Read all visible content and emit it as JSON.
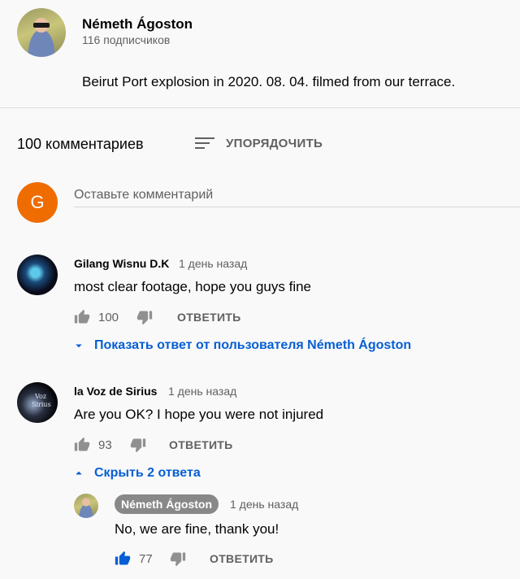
{
  "channel": {
    "name": "Németh Ágoston",
    "subscribers": "116 подписчиков",
    "description": "Beirut Port explosion in 2020. 08. 04. filmed from our terrace."
  },
  "comments_header": {
    "count": "100 комментариев",
    "sort_label": "УПОРЯДОЧИТЬ"
  },
  "add_comment": {
    "avatar_letter": "G",
    "placeholder": "Оставьте комментарий"
  },
  "comments": [
    {
      "author": "Gilang Wisnu D.K",
      "time": "1 день назад",
      "text": "most clear footage, hope you guys fine",
      "likes": "100",
      "reply_label": "ОТВЕТИТЬ",
      "toggle_label": "Показать ответ от пользователя Németh Ágoston"
    },
    {
      "author": "la Voz de Sirius",
      "time": "1 день назад",
      "text": "Are you OK? I hope you were not injured",
      "likes": "93",
      "reply_label": "ОТВЕТИТЬ",
      "toggle_label": "Скрыть 2 ответа",
      "avatar_text": [
        "Voz",
        "Sirius"
      ]
    }
  ],
  "reply": {
    "author": "Németh Ágoston",
    "time": "1 день назад",
    "text": "No, we are fine, thank you!",
    "likes": "77",
    "reply_label": "ОТВЕТИТЬ"
  },
  "colors": {
    "accent_blue": "#065fd4",
    "user_avatar": "#ef6c00",
    "secondary_text": "#606060"
  },
  "icons": [
    "sort-icon",
    "thumb-up-icon",
    "thumb-down-icon",
    "caret-down-icon",
    "caret-up-icon"
  ]
}
